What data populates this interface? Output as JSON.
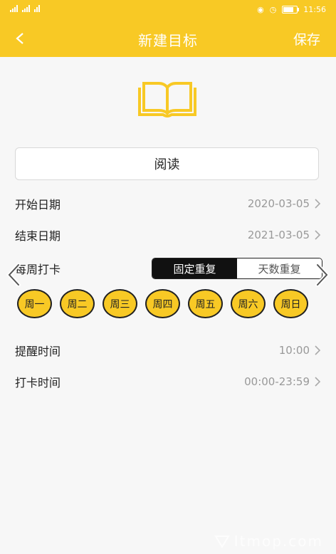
{
  "status_bar": {
    "time": "11:56"
  },
  "header": {
    "title": "新建目标",
    "save_label": "保存"
  },
  "goal": {
    "name": "阅读"
  },
  "rows": {
    "start_date": {
      "label": "开始日期",
      "value": "2020-03-05"
    },
    "end_date": {
      "label": "结束日期",
      "value": "2021-03-05"
    },
    "reminder": {
      "label": "提醒时间",
      "value": "10:00"
    },
    "checkin_time": {
      "label": "打卡时间",
      "value": "00:00-23:59"
    }
  },
  "repeat": {
    "label": "每周打卡",
    "options": [
      "固定重复",
      "天数重复"
    ],
    "selected": "固定重复"
  },
  "weekdays": [
    "周一",
    "周二",
    "周三",
    "周四",
    "周五",
    "周六",
    "周日"
  ],
  "colors": {
    "accent": "#f8c925",
    "selected_segment": "#111111"
  },
  "watermark": "Itmop.com"
}
